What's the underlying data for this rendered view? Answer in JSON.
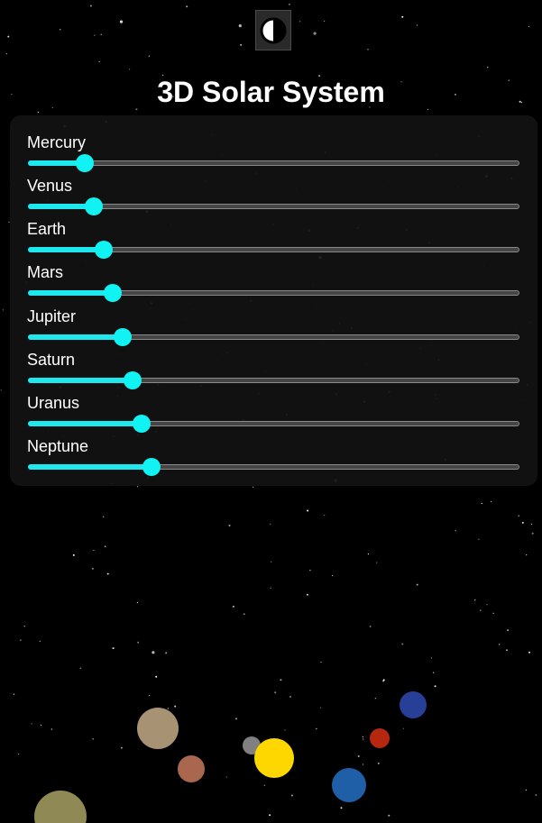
{
  "page": {
    "title": "3D Solar System"
  },
  "theme_toggle": {
    "icon": "contrast-icon"
  },
  "controls": {
    "planets": [
      {
        "label": "Mercury",
        "value": 0.115
      },
      {
        "label": "Venus",
        "value": 0.133
      },
      {
        "label": "Earth",
        "value": 0.153
      },
      {
        "label": "Mars",
        "value": 0.172
      },
      {
        "label": "Jupiter",
        "value": 0.192
      },
      {
        "label": "Saturn",
        "value": 0.211
      },
      {
        "label": "Uranus",
        "value": 0.231
      },
      {
        "label": "Neptune",
        "value": 0.251
      }
    ]
  },
  "colors": {
    "background": "#000000",
    "accent": "#11f2f2",
    "panel": "#121212",
    "sun": "#ffd700",
    "mercury": "#808080",
    "venus": "#a9674f",
    "earth": "#1f5fa8",
    "mars": "#b5280f",
    "jupiter": "#a89274",
    "saturn": "#8f8a55",
    "uranus": "#273f97"
  }
}
